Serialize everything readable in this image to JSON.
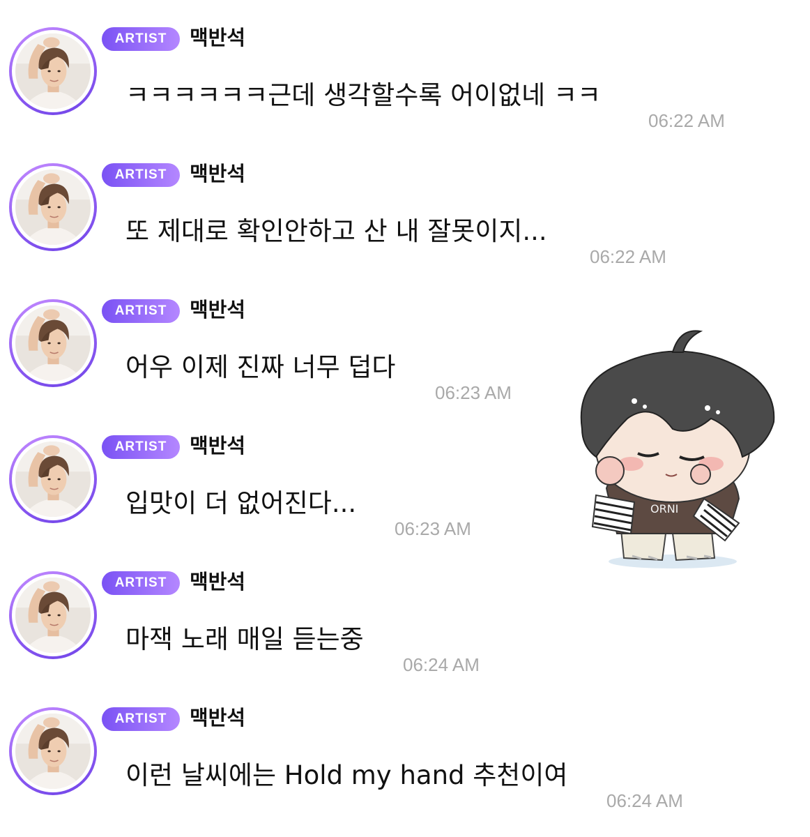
{
  "badge_label": "ARTIST",
  "sender_name": "맥반석",
  "colors": {
    "badge_start": "#7a52f4",
    "badge_end": "#b487ff",
    "avatar_ring": "#8f5cf2",
    "timestamp": "#a9a9a9",
    "text": "#111111"
  },
  "messages": [
    {
      "text": "ㅋㅋㅋㅋㅋㅋ근데 생각할수록 어이없네 ㅋㅋ",
      "time": "06:22 AM"
    },
    {
      "text": "또 제대로 확인안하고 산 내 잘못이지...",
      "time": "06:22 AM"
    },
    {
      "text": "어우 이제 진짜 너무 덥다",
      "time": "06:23 AM"
    },
    {
      "text": "입맛이 더 없어진다...",
      "time": "06:23 AM"
    },
    {
      "text": "마잭 노래 매일 듣는중",
      "time": "06:24 AM"
    },
    {
      "text": "이런 날씨에는 Hold my hand 추천이여",
      "time": "06:24 AM"
    }
  ],
  "sticker": {
    "icon": "chibi-character-sticker-icon",
    "shirt_text": "ORNI"
  }
}
